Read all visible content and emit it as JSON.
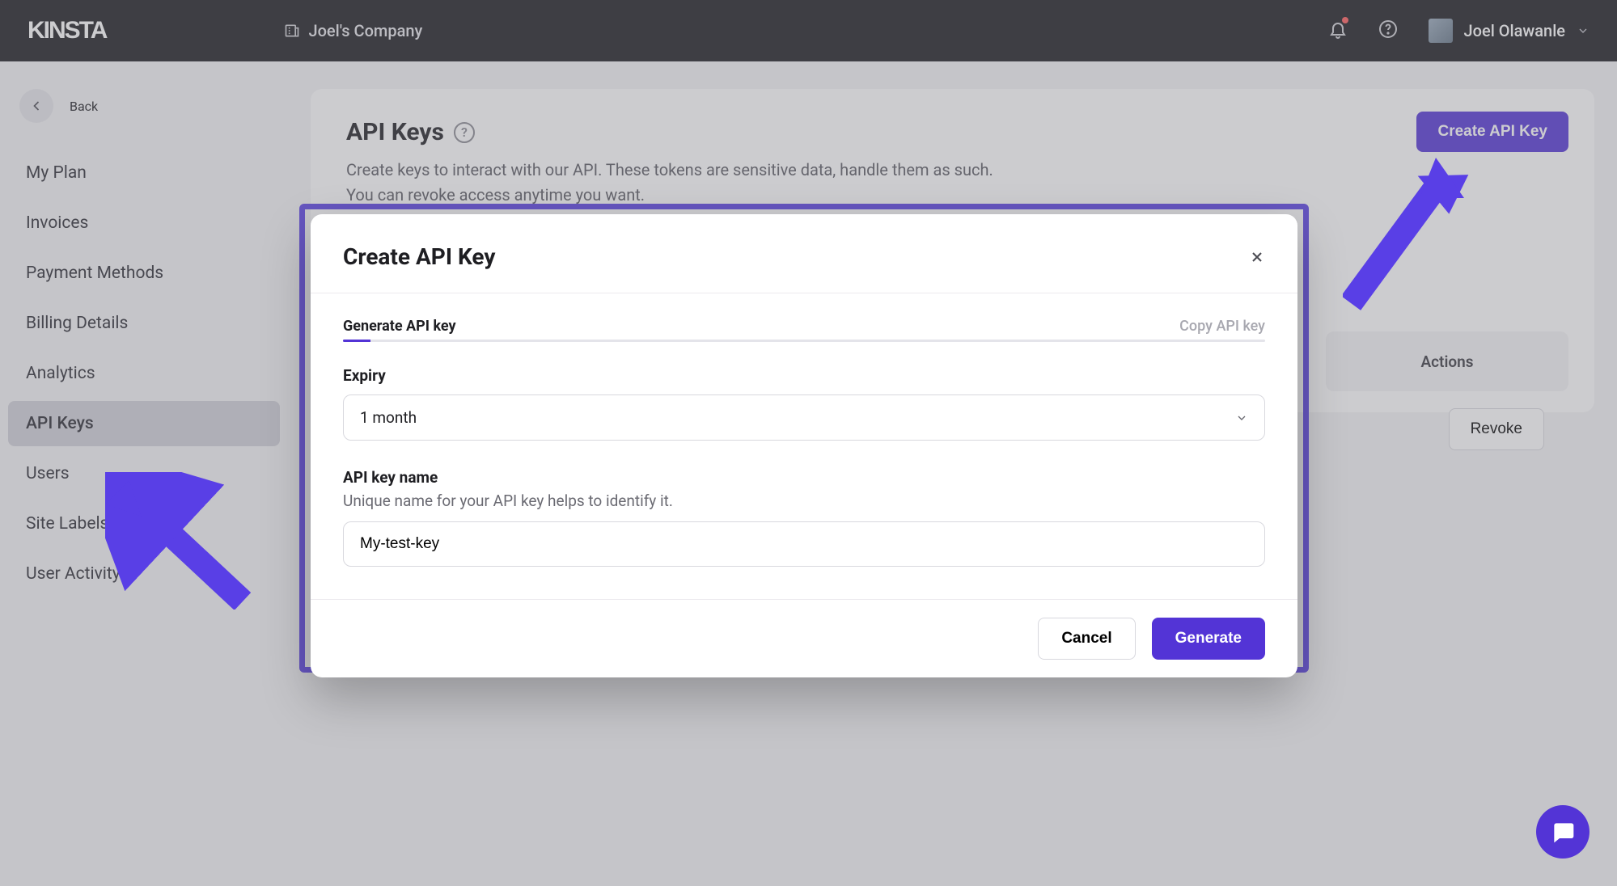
{
  "header": {
    "logo_text": "KINSTA",
    "company_name": "Joel's Company",
    "user_name": "Joel Olawanle"
  },
  "sidebar": {
    "back_label": "Back",
    "items": [
      {
        "label": "My Plan"
      },
      {
        "label": "Invoices"
      },
      {
        "label": "Payment Methods"
      },
      {
        "label": "Billing Details"
      },
      {
        "label": "Analytics"
      },
      {
        "label": "API Keys"
      },
      {
        "label": "Users"
      },
      {
        "label": "Site Labels"
      },
      {
        "label": "User Activity"
      }
    ],
    "active_index": 5
  },
  "page": {
    "title": "API Keys",
    "desc_line1": "Create keys to interact with our API. These tokens are sensitive data, handle them as such.",
    "desc_line2": "You can revoke access anytime you want.",
    "create_button": "Create API Key",
    "table_actions_header": "Actions",
    "revoke_button": "Revoke"
  },
  "modal": {
    "title": "Create API Key",
    "step_generate": "Generate API key",
    "step_copy": "Copy API key",
    "expiry_label": "Expiry",
    "expiry_value": "1 month",
    "key_name_label": "API key name",
    "key_name_sub": "Unique name for your API key helps to identify it.",
    "key_name_value": "My-test-key",
    "cancel": "Cancel",
    "generate": "Generate"
  }
}
